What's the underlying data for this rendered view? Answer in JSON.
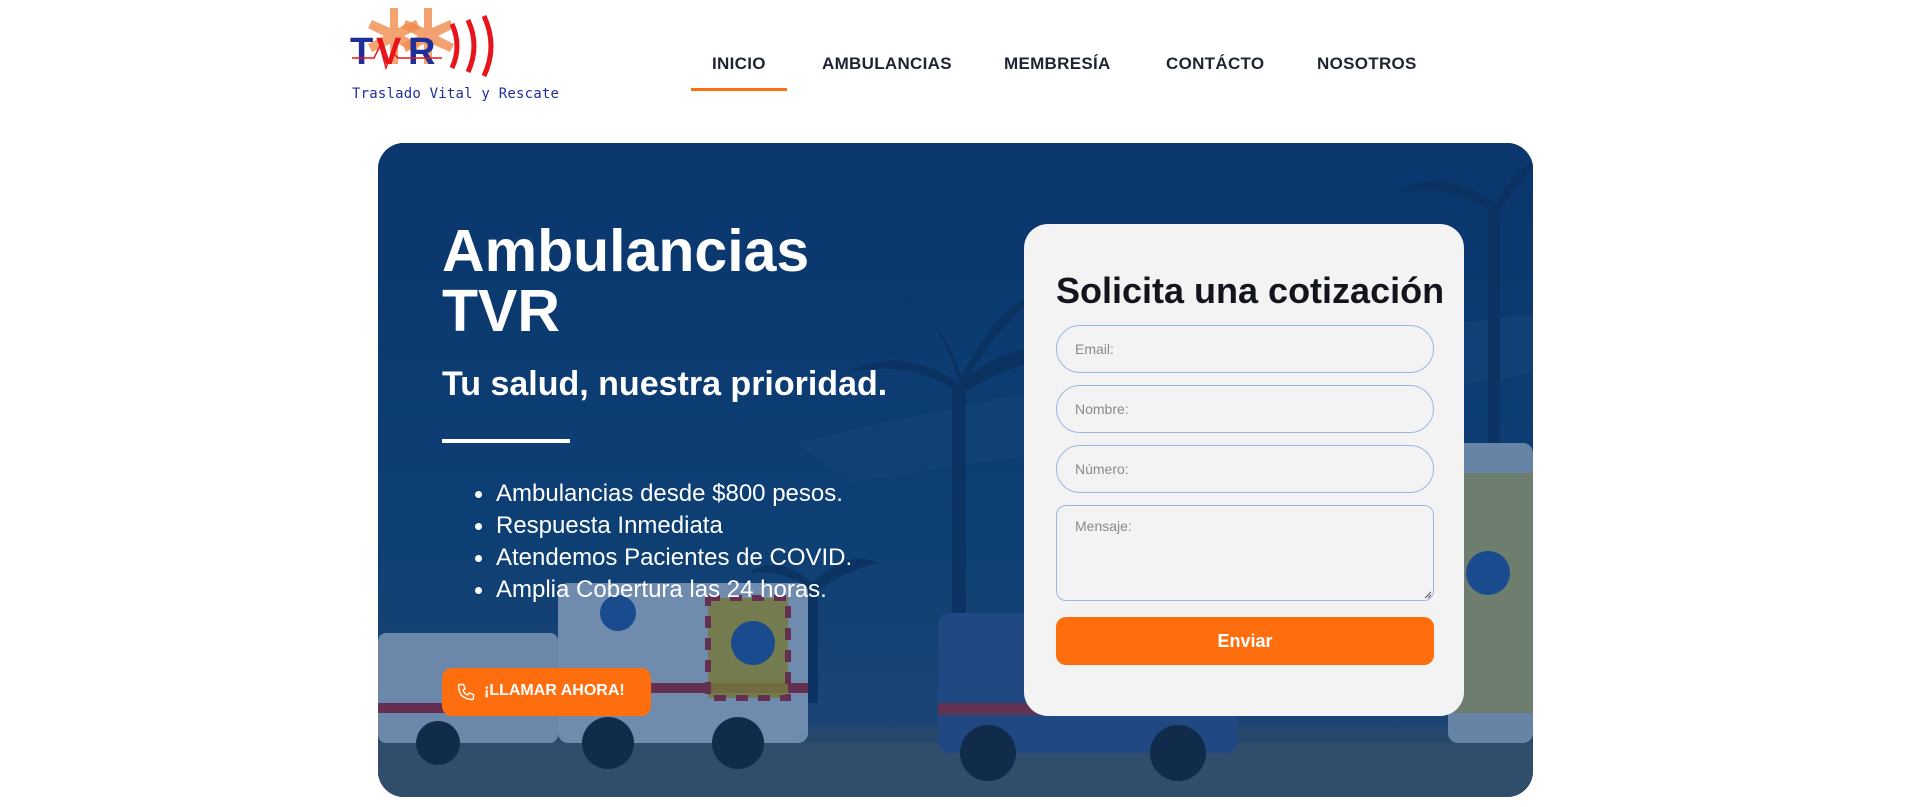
{
  "brand": {
    "logo_text": "TVR",
    "tagline": "Traslado Vital y Rescate"
  },
  "nav": {
    "items": [
      {
        "label": "INICIO",
        "active": true
      },
      {
        "label": "AMBULANCIAS",
        "active": false
      },
      {
        "label": "MEMBRESÍA",
        "active": false
      },
      {
        "label": "CONTÁCTO",
        "active": false
      },
      {
        "label": "NOSOTROS",
        "active": false
      }
    ]
  },
  "hero": {
    "title": "Ambulancias TVR",
    "subtitle": "Tu salud, nuestra prioridad.",
    "features": [
      "Ambulancias desde $800 pesos.",
      "Respuesta Inmediata",
      "Atendemos Pacientes de COVID.",
      "Amplia Cobertura las 24 horas."
    ],
    "call_button": "¡LLAMAR AHORA!",
    "call_icon": "phone-icon"
  },
  "form": {
    "title": "Solicita una cotización",
    "email_placeholder": "Email:",
    "nombre_placeholder": "Nombre:",
    "numero_placeholder": "Número:",
    "mensaje_placeholder": "Mensaje:",
    "submit_label": "Enviar"
  },
  "colors": {
    "accent": "#ff6e0e",
    "hero_blue": "#0d3d74",
    "form_bg": "#f3f3f3",
    "logo_blue": "#1f2f9a",
    "logo_red": "#e8141c"
  }
}
